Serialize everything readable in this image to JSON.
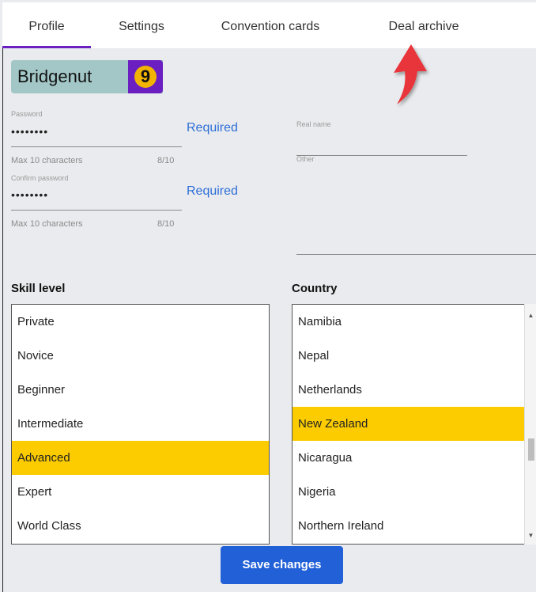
{
  "tabs": [
    {
      "label": "Profile",
      "active": true
    },
    {
      "label": "Settings",
      "active": false
    },
    {
      "label": "Convention cards",
      "active": false
    },
    {
      "label": "Deal archive",
      "active": false
    }
  ],
  "user": {
    "name": "Bridgenut",
    "level": "9"
  },
  "password": {
    "label": "Password",
    "value": "••••••••",
    "status": "Required",
    "hint": "Max 10 characters",
    "count": "8/10"
  },
  "confirm_password": {
    "label": "Confirm password",
    "value": "••••••••",
    "status": "Required",
    "hint": "Max 10 characters",
    "count": "8/10"
  },
  "real_name": {
    "label": "Real name",
    "value": ""
  },
  "other": {
    "label": "Other",
    "value": ""
  },
  "skill": {
    "label": "Skill level",
    "items": [
      "Private",
      "Novice",
      "Beginner",
      "Intermediate",
      "Advanced",
      "Expert",
      "World Class"
    ],
    "selected": "Advanced"
  },
  "country": {
    "label": "Country",
    "items": [
      "Namibia",
      "Nepal",
      "Netherlands",
      "New Zealand",
      "Nicaragua",
      "Nigeria",
      "Northern Ireland"
    ],
    "selected": "New Zealand"
  },
  "save_button": {
    "label": "Save changes"
  },
  "colors": {
    "accent": "#6b1fc1",
    "selection": "#fccc00",
    "primary_button": "#2260d8",
    "link": "#2f6fd6",
    "annotation_arrow": "#e8343a"
  }
}
